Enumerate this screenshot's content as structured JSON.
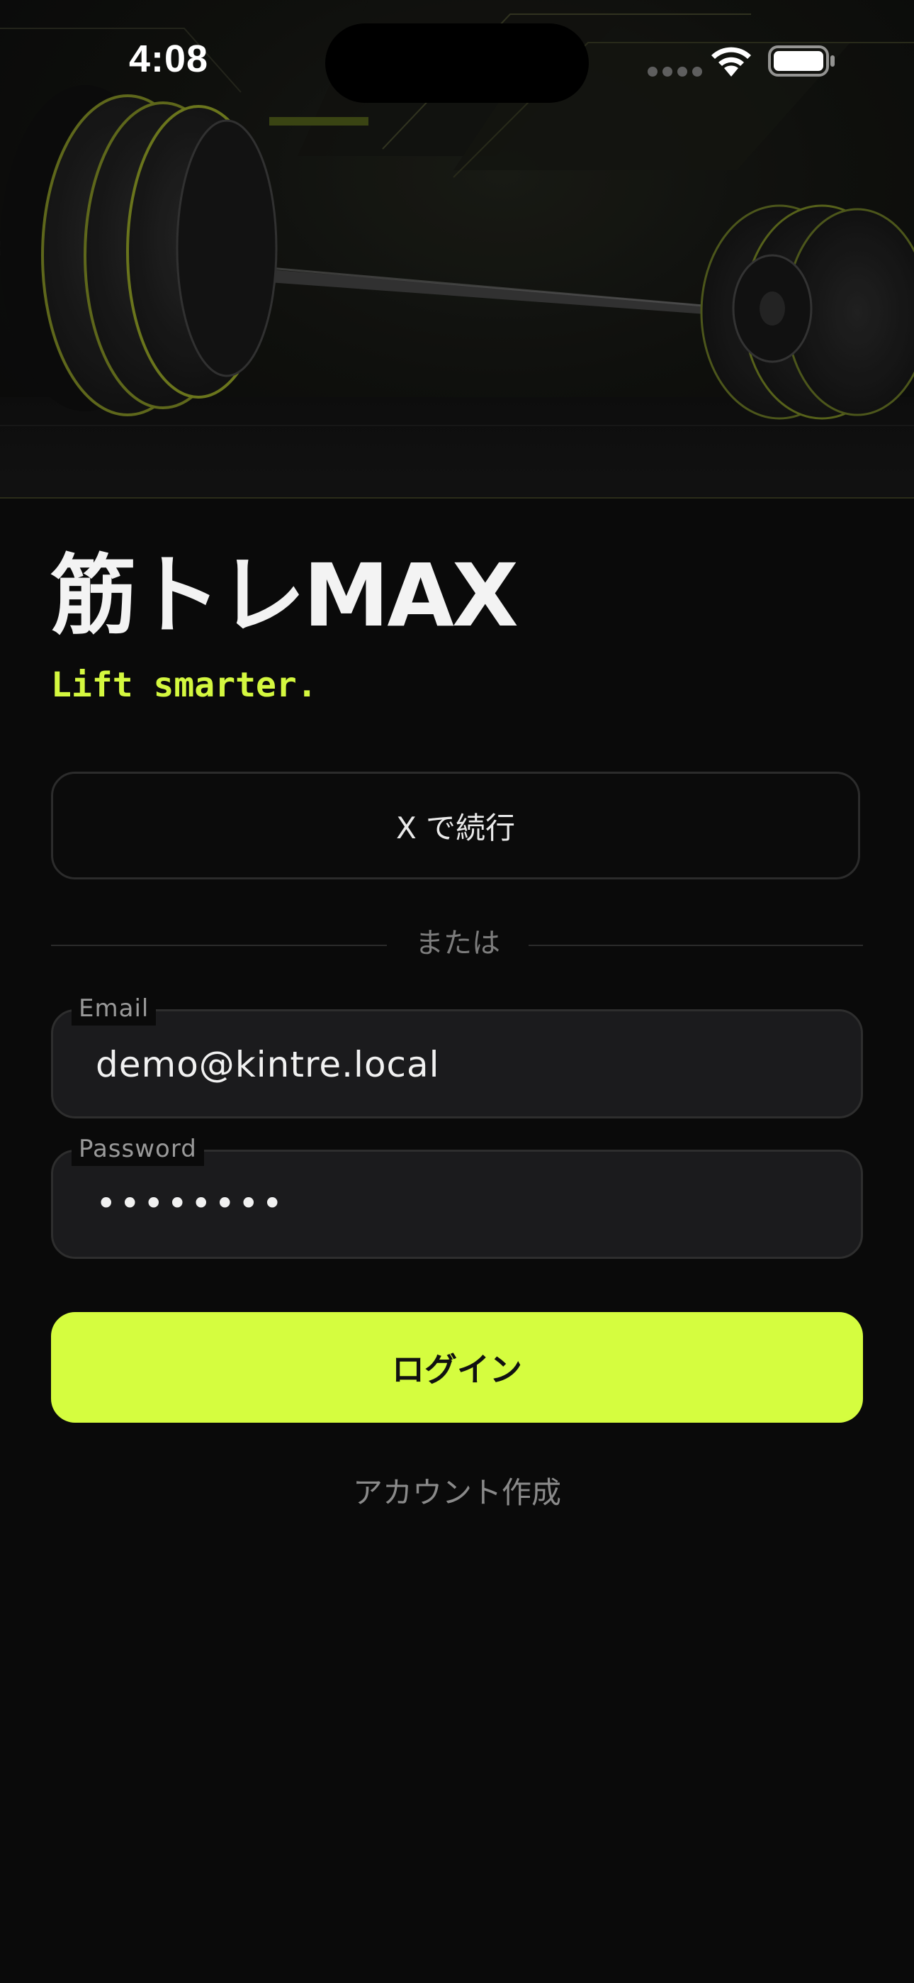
{
  "status_bar": {
    "time": "4:08"
  },
  "app": {
    "title": "筋トレMAX",
    "tagline": "Lift smarter."
  },
  "social_login": {
    "x_label": "X で続行"
  },
  "divider": {
    "text": "または"
  },
  "form": {
    "email_label": "Email",
    "email_value": "demo@kintre.local",
    "password_label": "Password",
    "password_value": "••••••••"
  },
  "actions": {
    "login_label": "ログイン",
    "signup_label": "アカウント作成"
  },
  "colors": {
    "accent": "#d5fd3f",
    "background": "#0a0a0a",
    "field_background": "#1b1b1d"
  },
  "icons": {
    "wifi": "wifi-icon",
    "battery": "battery-icon",
    "cellular": "cellular-signal-icon",
    "hero": "barbell-image"
  }
}
